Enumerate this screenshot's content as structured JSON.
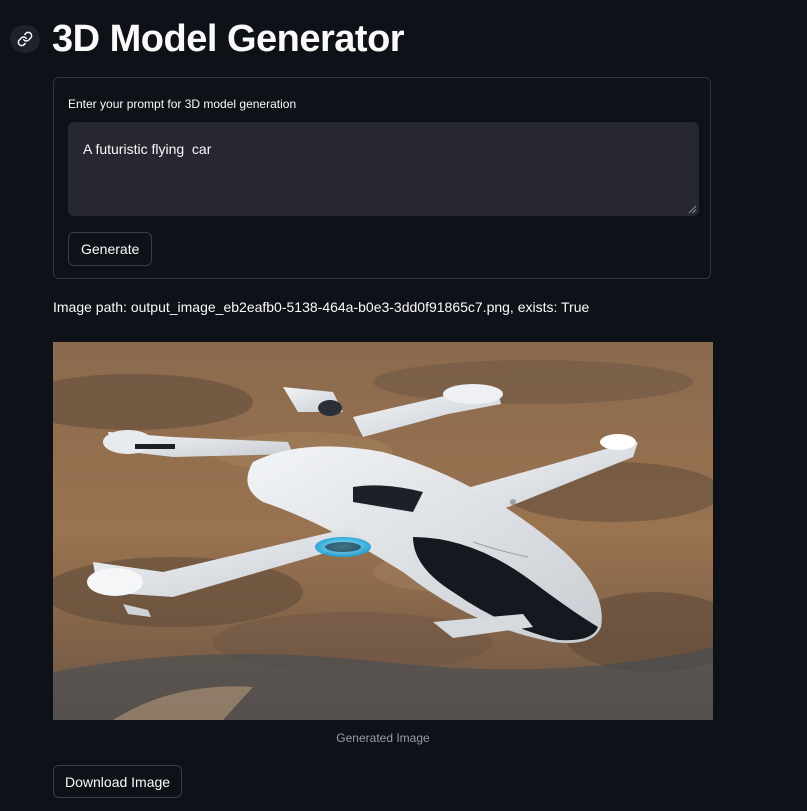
{
  "header": {
    "title": "3D Model Generator",
    "anchor_icon": "link-icon"
  },
  "form": {
    "prompt_label": "Enter your prompt for 3D model generation",
    "prompt_value": "A futuristic flying  car",
    "generate_label": "Generate"
  },
  "result": {
    "image_path_text": "Image path: output_image_eb2eafb0-5138-464a-b0e3-3dd0f91865c7.png, exists: True",
    "image_subject": "aerial render of a white futuristic flying car with four rotor arms over desert mountains",
    "caption": "Generated Image",
    "download_label": "Download Image"
  },
  "colors": {
    "background": "#0e1117",
    "input_background": "#262730",
    "border": "#31333f",
    "text": "#fafafa",
    "caption": "#9a9ca3",
    "accent_glow": "#3fd0ff"
  }
}
